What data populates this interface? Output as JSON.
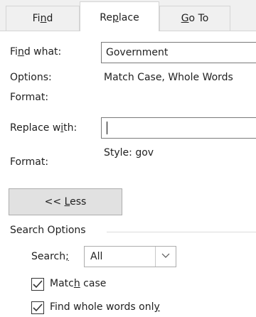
{
  "tabs": [
    {
      "label_pre": "Fi",
      "label_ul": "n",
      "label_post": "d"
    },
    {
      "label_pre": "Re",
      "label_ul": "p",
      "label_post": "lace"
    },
    {
      "label_pre": "",
      "label_ul": "G",
      "label_post": "o To"
    }
  ],
  "find": {
    "label_pre": "Fi",
    "label_ul": "n",
    "label_post": "d what:",
    "value": "Government",
    "options_label": "Options:",
    "options_value": "Match Case, Whole Words",
    "format_label": "Format:"
  },
  "replace": {
    "label_pre": "Replace w",
    "label_ul": "i",
    "label_post": "th:",
    "value": "",
    "format_label": "Format:",
    "format_value": "Style: gov"
  },
  "less_button": {
    "pre": "<< ",
    "ul": "L",
    "post": "ess"
  },
  "search_options": {
    "title": "Search Options",
    "search_label_pre": "Search",
    "search_label_ul": ";",
    "search_label_post": "",
    "search_value": "All",
    "match_case": {
      "pre": "Matc",
      "ul": "h",
      "post": " case",
      "checked": true
    },
    "whole_words": {
      "pre": "Find whole words onl",
      "ul": "y",
      "post": "",
      "checked": true
    }
  }
}
